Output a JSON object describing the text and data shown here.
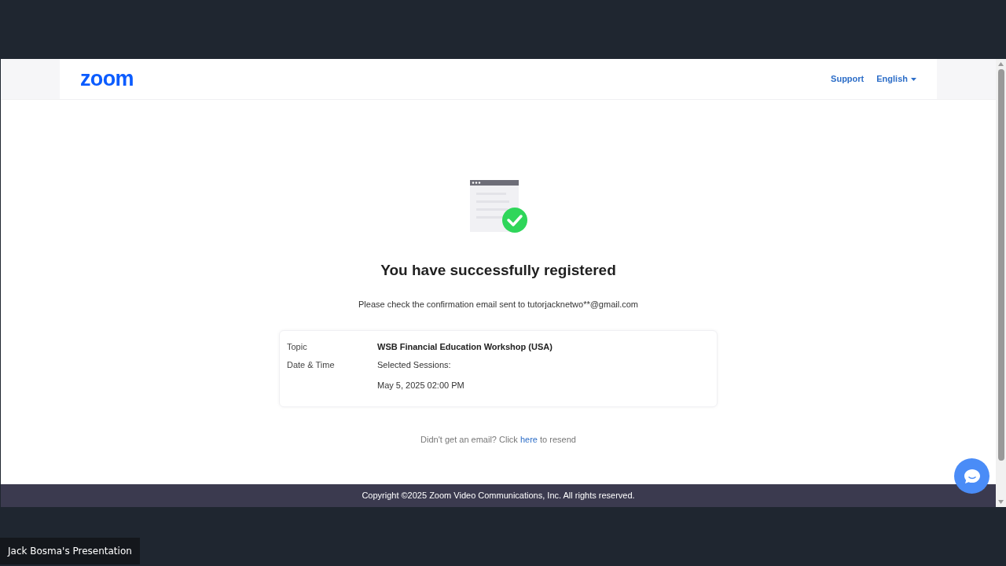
{
  "header": {
    "logo": "zoom",
    "links": [
      {
        "label": "Support",
        "kind": "link"
      },
      {
        "label": "English",
        "kind": "dropdown"
      }
    ]
  },
  "title": "You have successfully registered",
  "message": "Please check the confirmation email sent to tutorjacknetwo**@gmail.com",
  "details": [
    {
      "label": "Topic",
      "lines": [
        "WSB Financial Education Workshop (USA)"
      ],
      "bold": true
    },
    {
      "label": "Date & Time",
      "lines": [
        "Selected Sessions:",
        "May 5, 2025 02:00 PM"
      ],
      "bold": false
    }
  ],
  "resend": {
    "before": "Didn't get an email? Click",
    "link": "here",
    "after": "to resend"
  },
  "footer": "Copyright ©2025 Zoom Video Communications, Inc. All rights reserved.",
  "presenter_label": "Jack Bosma's Presentation"
}
